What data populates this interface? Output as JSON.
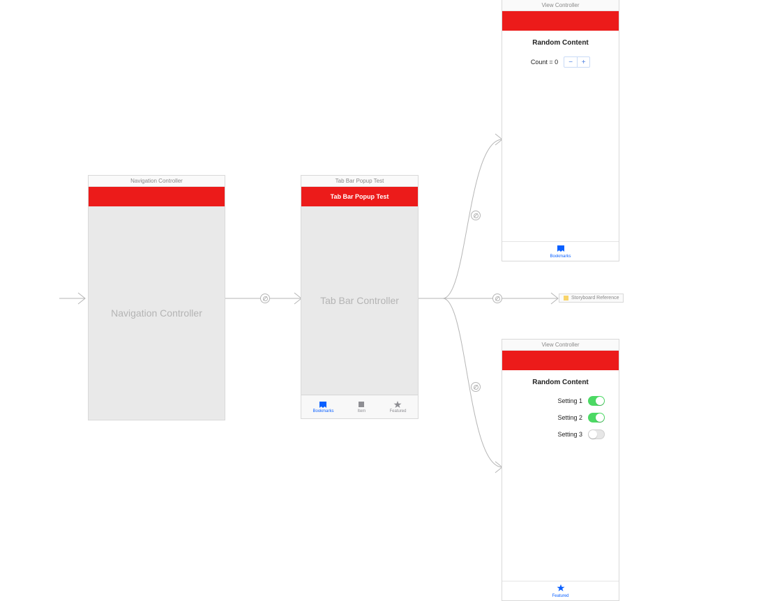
{
  "scene1": {
    "title": "Navigation Controller",
    "placeholder": "Navigation Controller"
  },
  "scene2": {
    "title": "Tab Bar Popup Test",
    "nav_title": "Tab Bar Popup Test",
    "placeholder": "Tab Bar Controller",
    "tabs": [
      {
        "label": "Bookmarks",
        "icon": "bookmarks-icon",
        "active": true
      },
      {
        "label": "Item",
        "icon": "square-icon",
        "active": false
      },
      {
        "label": "Featured",
        "icon": "star-icon",
        "active": false
      }
    ]
  },
  "scene3": {
    "title": "View Controller",
    "heading": "Random Content",
    "count_label": "Count = 0",
    "stepper_minus": "−",
    "stepper_plus": "+",
    "tab": {
      "label": "Bookmarks",
      "icon": "bookmarks-icon"
    }
  },
  "sbref": {
    "label": "Storyboard Reference"
  },
  "scene4": {
    "title": "View Controller",
    "heading": "Random Content",
    "settings": [
      {
        "label": "Setting 1",
        "on": true
      },
      {
        "label": "Setting 2",
        "on": true
      },
      {
        "label": "Setting 3",
        "on": false
      }
    ],
    "tab": {
      "label": "Featured",
      "icon": "star-icon"
    }
  },
  "colors": {
    "red": "#ec1b1a",
    "blue": "#0a60ff",
    "green": "#4cd964"
  }
}
